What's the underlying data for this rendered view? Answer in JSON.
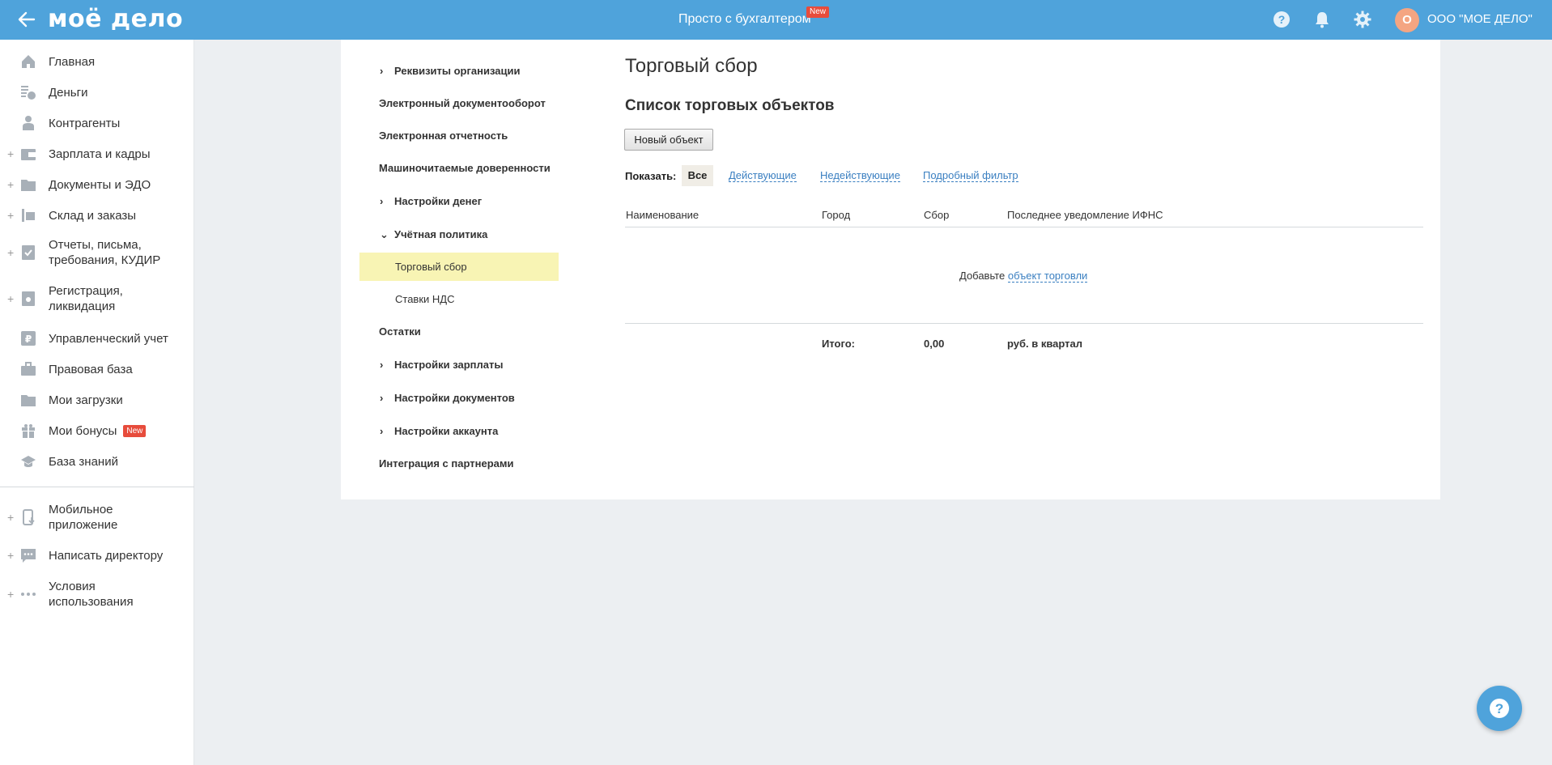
{
  "header": {
    "logo": "моё дело",
    "promo_text": "Просто с бухгалтером",
    "promo_badge": "New",
    "company_initial": "О",
    "company_name": "ООО \"МОЕ ДЕЛО\""
  },
  "sidebar": {
    "items": [
      {
        "label": "Главная",
        "icon": "home-icon"
      },
      {
        "label": "Деньги",
        "icon": "money-icon"
      },
      {
        "label": "Контрагенты",
        "icon": "contractors-icon"
      },
      {
        "label": "Зарплата и кадры",
        "icon": "salary-icon"
      },
      {
        "label": "Документы и ЭДО",
        "icon": "documents-icon"
      },
      {
        "label": "Склад и заказы",
        "icon": "warehouse-icon"
      },
      {
        "label": "Отчеты, письма, требования, КУДИР",
        "icon": "reports-icon"
      },
      {
        "label": "Регистрация, ликвидация",
        "icon": "registration-icon"
      },
      {
        "label": "Управленческий учет",
        "icon": "management-icon"
      },
      {
        "label": "Правовая база",
        "icon": "briefcase-icon"
      },
      {
        "label": "Мои загрузки",
        "icon": "folder-icon"
      },
      {
        "label": "Мои бонусы",
        "icon": "gift-icon",
        "badge": "New"
      },
      {
        "label": "База знаний",
        "icon": "graduation-cap-icon"
      },
      {
        "label": "Мобильное приложение",
        "icon": "mobile-icon"
      },
      {
        "label": "Написать директору",
        "icon": "chat-icon"
      },
      {
        "label": "Условия использования",
        "icon": "more-icon"
      }
    ]
  },
  "settings_menu": {
    "items": [
      {
        "label": "Реквизиты организации"
      },
      {
        "label": "Электронный документооборот"
      },
      {
        "label": "Электронная отчетность"
      },
      {
        "label": "Машиночитаемые доверенности"
      },
      {
        "label": "Настройки денег"
      },
      {
        "label": "Учётная политика"
      },
      {
        "label": "Остатки"
      },
      {
        "label": "Настройки зарплаты"
      },
      {
        "label": "Настройки документов"
      },
      {
        "label": "Настройки аккаунта"
      },
      {
        "label": "Интеграция с партнерами"
      }
    ],
    "subitems": [
      {
        "label": "Торговый сбор",
        "active": true
      },
      {
        "label": "Ставки НДС",
        "active": false
      }
    ]
  },
  "main": {
    "title": "Торговый сбор",
    "section_title": "Список торговых объектов",
    "new_object_button": "Новый объект",
    "filter": {
      "label": "Показать:",
      "all": "Все",
      "active": "Действующие",
      "inactive": "Недействующие",
      "detailed": "Подробный фильтр"
    },
    "table": {
      "columns": [
        "Наименование",
        "Город",
        "Сбор",
        "Последнее уведомление ИФНС"
      ],
      "empty_prefix": "Добавьте",
      "empty_link": "объект торговли"
    },
    "total": {
      "label": "Итого:",
      "value": "0,00",
      "unit": "руб. в квартал"
    }
  },
  "colors": {
    "header_bg": "#4fa3db",
    "active_item_bg": "#f8f4b4",
    "link": "#3a7fc1",
    "badge": "#e74c3c"
  }
}
